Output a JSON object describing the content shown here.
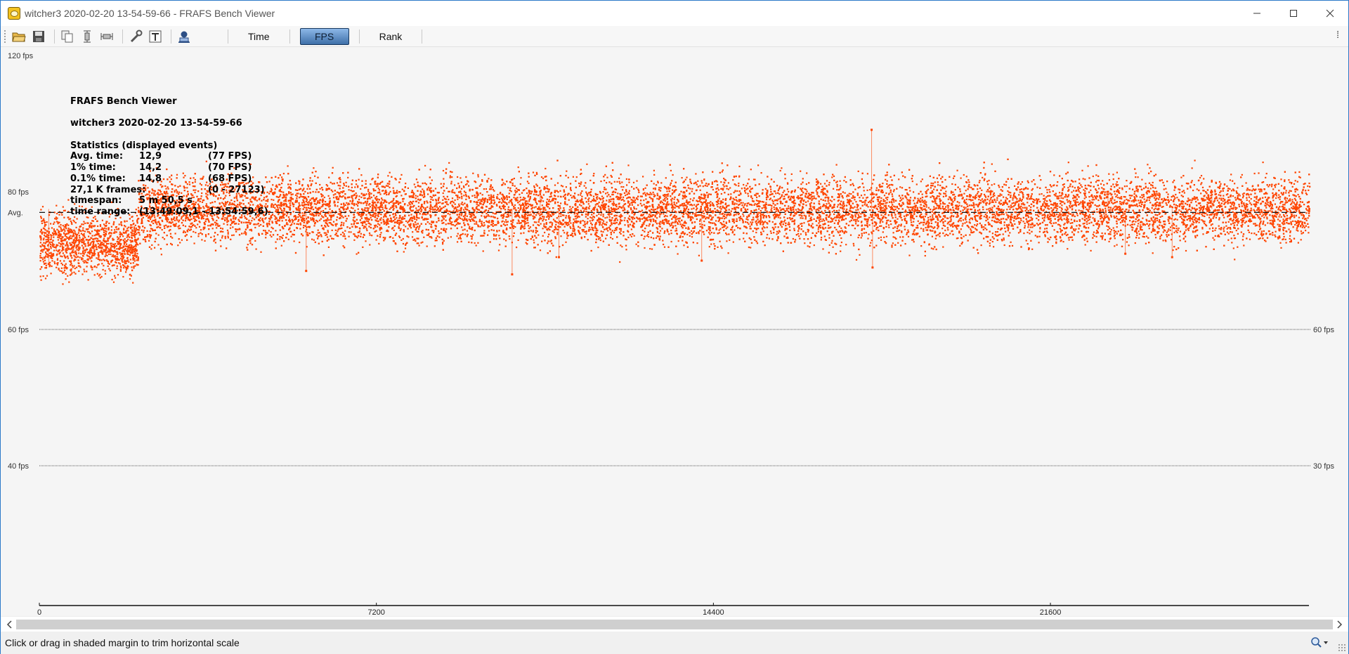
{
  "window": {
    "title": "witcher3 2020-02-20 13-54-59-66 - FRAFS Bench Viewer"
  },
  "toolbar": {
    "icons": [
      "open-icon",
      "save-icon",
      "copy-icon",
      "vertical-scale-icon",
      "horizontal-scale-icon",
      "settings-icon",
      "text-icon",
      "user-icon"
    ],
    "tabs": [
      {
        "label": "Time",
        "active": false
      },
      {
        "label": "FPS",
        "active": true
      },
      {
        "label": "Rank",
        "active": false
      }
    ],
    "overflow_label": "⁞"
  },
  "overlay": {
    "app_name": "FRAFS Bench Viewer",
    "file_name": "witcher3 2020-02-20 13-54-59-66",
    "stats_heading": "Statistics (displayed events)",
    "stats": [
      [
        "Avg. time:",
        "12,9",
        "(77 FPS)"
      ],
      [
        "1% time:",
        "14,2",
        "(70 FPS)"
      ],
      [
        "0.1% time:",
        "14,8",
        "(68 FPS)"
      ],
      [
        "27,1 K frames:",
        "",
        "(0 - 27123)"
      ],
      [
        "timespan:",
        "5 m 50,5 s",
        ""
      ],
      [
        "time range:",
        "(13:49:09,1 - 13:54:59,6)",
        ""
      ]
    ]
  },
  "chart_data": {
    "type": "scatter",
    "title": "",
    "xlabel": "",
    "ylabel": "",
    "series_color": "#ff4500",
    "xlim": [
      0,
      27123
    ],
    "x_ticks": [
      0,
      7200,
      14400,
      21600
    ],
    "x_tick_labels": [
      "0",
      "7200",
      "14400",
      "21600"
    ],
    "left_tick_labels": [
      {
        "value": 120,
        "label": "120 fps"
      },
      {
        "value": 80,
        "label": "80 fps"
      },
      {
        "value": 77,
        "label": "Avg."
      },
      {
        "value": 60,
        "label": "60 fps"
      },
      {
        "value": 40,
        "label": "40 fps"
      }
    ],
    "right_tick_labels": [
      {
        "value": 60,
        "label": "60 fps"
      },
      {
        "value": 40,
        "label": "30 fps"
      }
    ],
    "avg_fps": 77,
    "reference_lines_fps": [
      60,
      40
    ],
    "segments": [
      {
        "x_start": 0,
        "x_end": 2100,
        "fps_center": 72.5,
        "fps_spread": 2.2
      },
      {
        "x_start": 2100,
        "x_end": 27123,
        "fps_center": 77.5,
        "fps_spread": 2.4
      }
    ],
    "outlier_spikes": [
      {
        "x": 17780,
        "fps": 89
      },
      {
        "x": 22830,
        "fps": 80
      },
      {
        "x": 25050,
        "fps": 80
      },
      {
        "x": 10700,
        "fps": 80
      },
      {
        "x": 2350,
        "fps": 80
      },
      {
        "x": 10100,
        "fps": 68
      },
      {
        "x": 5700,
        "fps": 68.5
      },
      {
        "x": 17800,
        "fps": 69
      },
      {
        "x": 14150,
        "fps": 70
      },
      {
        "x": 200,
        "fps": 69.5
      },
      {
        "x": 23200,
        "fps": 71
      },
      {
        "x": 24200,
        "fps": 70.5
      },
      {
        "x": 11100,
        "fps": 70.5
      }
    ]
  },
  "scrollbar": {
    "left_arrow": "‹",
    "right_arrow": "›"
  },
  "status": {
    "text": "Click or drag in shaded margin to trim horizontal scale"
  }
}
